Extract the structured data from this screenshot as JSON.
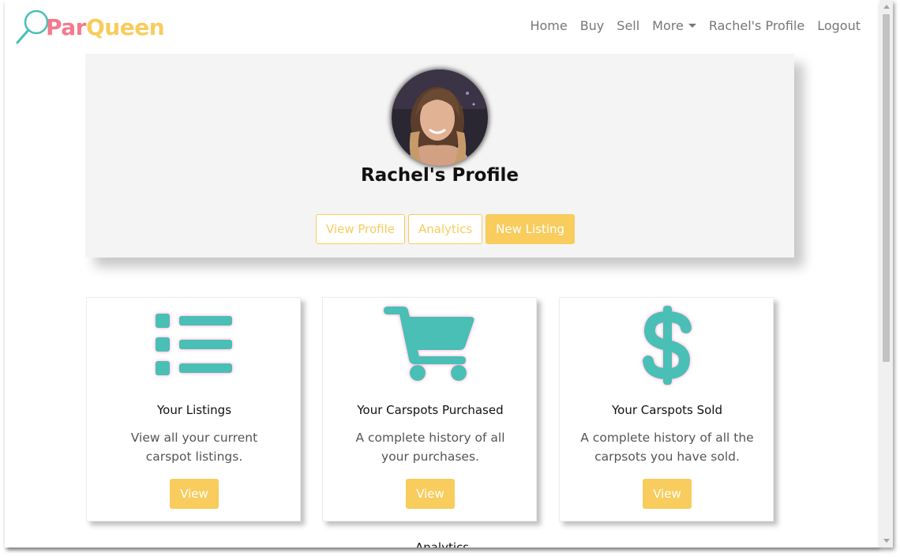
{
  "brand": {
    "part1": "Par",
    "part2": "Queen"
  },
  "nav": {
    "home": "Home",
    "buy": "Buy",
    "sell": "Sell",
    "more": "More",
    "profile": "Rachel's Profile",
    "logout": "Logout"
  },
  "profile": {
    "title": "Rachel's Profile",
    "buttons": {
      "view_profile": "View Profile",
      "analytics": "Analytics",
      "new_listing": "New Listing"
    }
  },
  "cards": [
    {
      "icon": "list-icon",
      "title": "Your Listings",
      "desc": "View all your current carspot listings.",
      "button": "View"
    },
    {
      "icon": "shopping-cart-icon",
      "title": "Your Carspots Purchased",
      "desc": "A complete history of all your purchases.",
      "button": "View"
    },
    {
      "icon": "dollar-sign-icon",
      "title": "Your Carspots Sold",
      "desc": "A complete history of all the carpsots you have sold.",
      "button": "View"
    }
  ],
  "section_heading": "Analytics",
  "colors": {
    "accent": "#f8cc5d",
    "pink": "#f4798c",
    "teal": "#48bfb6",
    "nav_text": "#777777"
  }
}
